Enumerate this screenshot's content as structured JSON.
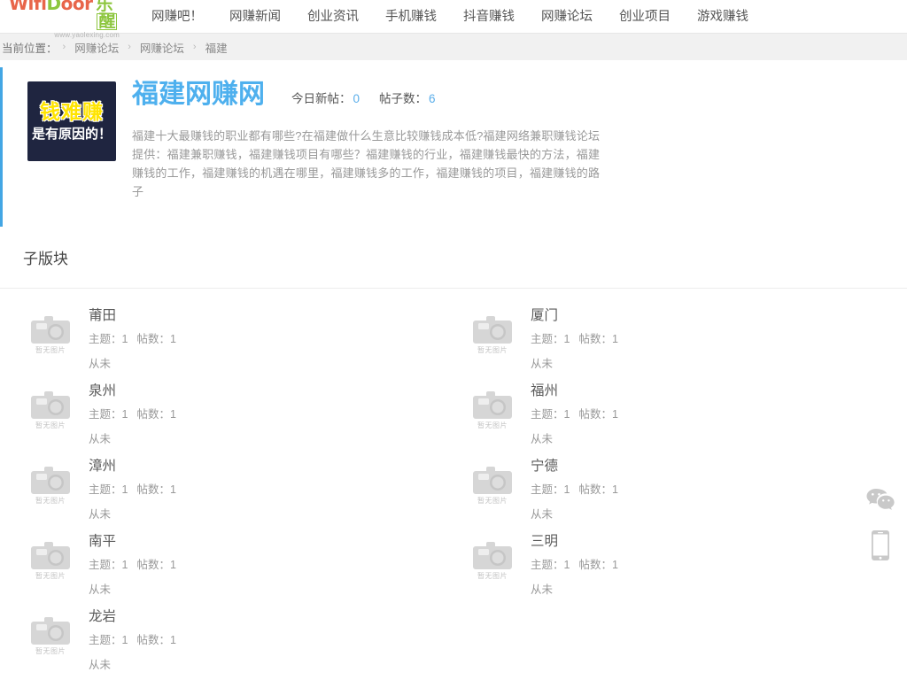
{
  "header": {
    "logo": {
      "brand_part1": "Wifi",
      "brand_part2": "D",
      "brand_part3": "oor",
      "brand_cn": "乐",
      "brand_cn_boxed": "醒",
      "url": "www.yaolexing.com",
      "color_orange": "#e8654a",
      "color_green": "#8dc63f"
    },
    "nav": [
      {
        "label": "网赚吧！"
      },
      {
        "label": "网赚新闻"
      },
      {
        "label": "创业资讯"
      },
      {
        "label": "手机赚钱"
      },
      {
        "label": "抖音赚钱"
      },
      {
        "label": "网赚论坛"
      },
      {
        "label": "创业项目"
      },
      {
        "label": "游戏赚钱"
      }
    ]
  },
  "breadcrumb": {
    "label": "当前位置：",
    "items": [
      {
        "label": "网赚论坛"
      },
      {
        "label": "网赚论坛"
      }
    ],
    "current": "福建",
    "separator": "›"
  },
  "forum": {
    "badge_line1": "钱难赚",
    "badge_line2": "是有原因的！",
    "title": "福建网赚网",
    "stats": [
      {
        "label": "今日新帖：",
        "value": "0"
      },
      {
        "label": "帖子数：",
        "value": "6"
      }
    ],
    "description": "福建十大最赚钱的职业都有哪些?在福建做什么生意比较赚钱成本低?福建网络兼职赚钱论坛提供：福建兼职赚钱，福建赚钱项目有哪些？福建赚钱的行业，福建赚钱最快的方法，福建赚钱的工作，福建赚钱的机遇在哪里，福建赚钱多的工作，福建赚钱的项目，福建赚钱的路子",
    "accent_color": "#43a6e4",
    "title_color": "#4eb0ee"
  },
  "subforums": {
    "section_title": "子版块",
    "thumb_caption": "暂无图片",
    "labels": {
      "topics": "主题：",
      "posts": "帖数：",
      "last": "从未"
    },
    "items": [
      {
        "name": "莆田",
        "topics": "1",
        "posts": "1",
        "last": "从未"
      },
      {
        "name": "厦门",
        "topics": "1",
        "posts": "1",
        "last": "从未"
      },
      {
        "name": "泉州",
        "topics": "1",
        "posts": "1",
        "last": "从未"
      },
      {
        "name": "福州",
        "topics": "1",
        "posts": "1",
        "last": "从未"
      },
      {
        "name": "漳州",
        "topics": "1",
        "posts": "1",
        "last": "从未"
      },
      {
        "name": "宁德",
        "topics": "1",
        "posts": "1",
        "last": "从未"
      },
      {
        "name": "南平",
        "topics": "1",
        "posts": "1",
        "last": "从未"
      },
      {
        "name": "三明",
        "topics": "1",
        "posts": "1",
        "last": "从未"
      },
      {
        "name": "龙岩",
        "topics": "1",
        "posts": "1",
        "last": "从未"
      }
    ]
  },
  "side_tools": [
    {
      "icon": "wechat-icon"
    },
    {
      "icon": "mobile-phone-icon"
    }
  ]
}
